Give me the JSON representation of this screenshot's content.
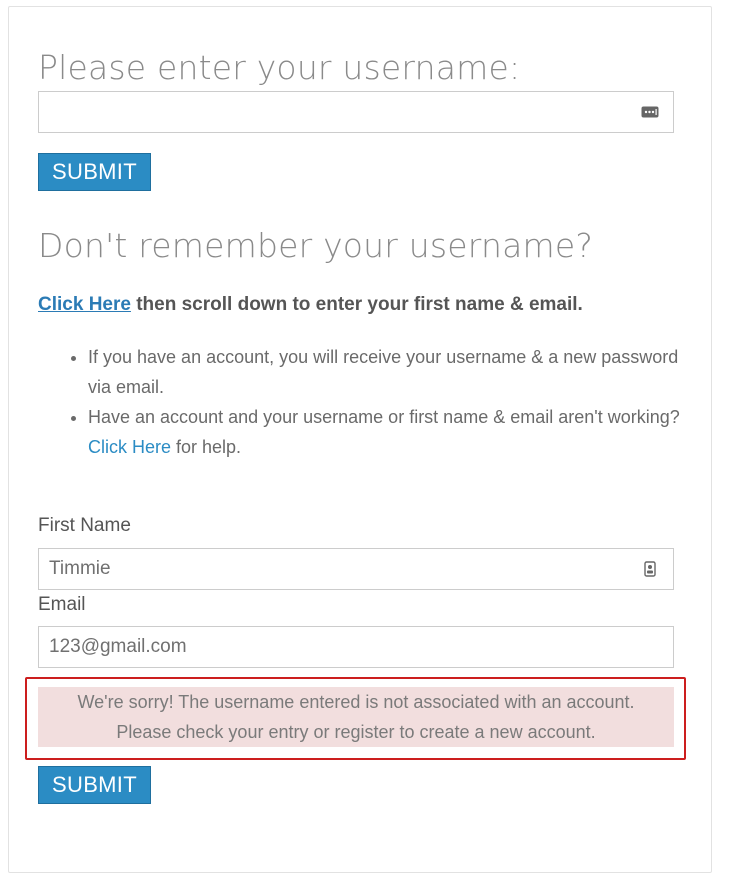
{
  "username_section": {
    "heading": "Please enter your username:",
    "input_value": "",
    "submit_label": "SUBMIT"
  },
  "forgot_section": {
    "heading": "Don't remember your username?",
    "lead_link": "Click Here",
    "lead_text": " then scroll down to enter your first name & email.",
    "bullets": [
      {
        "text": "If you have an account, you will receive your username & a new password via email."
      },
      {
        "text_before": "Have an account and your username or first name & email aren't working? ",
        "link": "Click Here",
        "text_after": " for help."
      }
    ]
  },
  "form": {
    "first_name_label": "First Name",
    "first_name_value": "Timmie",
    "email_label": "Email",
    "email_value": "123@gmail.com",
    "error_line1": "We're sorry! The username entered is not associated with an account.",
    "error_line2": "Please check your entry or register to create a new account.",
    "submit_label": "SUBMIT"
  },
  "colors": {
    "button": "#2b8cc4",
    "link": "#2b7bb5",
    "error_background": "#f2dede",
    "error_outline": "#cc1e1e"
  },
  "icons": {
    "username_input": "password-manager-icon",
    "first_name_input": "contact-card-icon"
  }
}
